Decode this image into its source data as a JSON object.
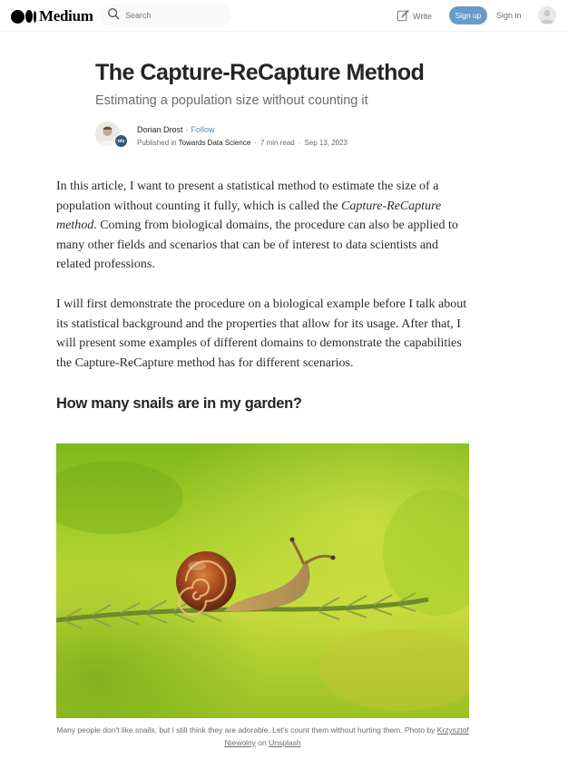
{
  "nav": {
    "logo_text": "Medium",
    "search_placeholder": "Search",
    "write_label": "Write",
    "signup_label": "Sign up",
    "signin_label": "Sign in",
    "accent_color": "#6a9bc7"
  },
  "article": {
    "title": "The Capture-ReCapture Method",
    "subtitle": "Estimating a population size without counting it",
    "author": "Dorian Drost",
    "follow_label": "Follow",
    "published_in_prefix": "Published in",
    "publication": "Towards Data Science",
    "read_time": "7 min read",
    "date": "Sep 13, 2023",
    "badge_text": "tds",
    "paragraph1": {
      "before_em": "In this article, I want to present a statistical method to estimate the size of a population without counting it fully, which is called the ",
      "em": "Capture-ReCapture method",
      "after_em": ". Coming from biological domains, the procedure can also be applied to many other fields and scenarios that can be of interest to data scientists and related professions."
    },
    "paragraph2": "I will first demonstrate the procedure on a biological example before I talk about its statistical background and the properties that allow for its usage. After that, I will present some examples of different domains to demonstrate the capabilities the Capture-ReCapture method has for different scenarios.",
    "heading": "How many snails are in my garden?",
    "caption": {
      "text": "Many people don't like snails, but I still think they are adorable. Let's count them without hurting them. Photo by ",
      "photographer": "Krzysztof Niewolny",
      "on": " on ",
      "source": "Unsplash"
    }
  }
}
